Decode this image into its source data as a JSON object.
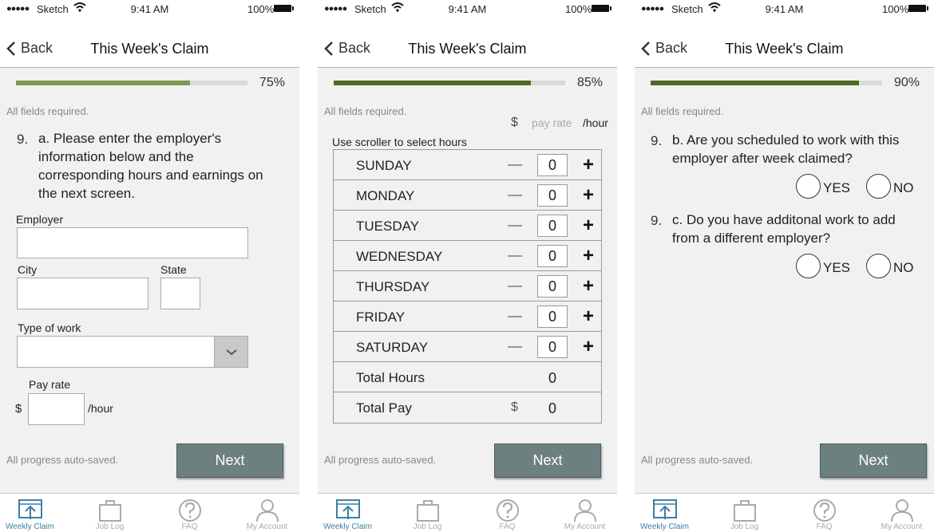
{
  "status": {
    "carrier": "Sketch",
    "time": "9:41 AM",
    "battery": "100%"
  },
  "nav": {
    "back": "Back",
    "title": "This Week's Claim"
  },
  "colors": {
    "progress_light": "#7a9a52",
    "progress_dark": "#4e6b24",
    "button": "#6d8080",
    "active_tab": "#3d7fa6"
  },
  "common": {
    "required": "All fields required.",
    "autosave": "All progress auto-saved.",
    "next": "Next"
  },
  "tabs": [
    {
      "label": "Weekly Claim",
      "icon": "upload-icon"
    },
    {
      "label": "Job Log",
      "icon": "briefcase-icon"
    },
    {
      "label": "FAQ",
      "icon": "question-icon"
    },
    {
      "label": "My Account",
      "icon": "person-icon"
    }
  ],
  "screen1": {
    "progress": 0.75,
    "progress_label": "75%",
    "question_num": "9.",
    "question": "a. Please enter the employer's information below and the corresponding hours and earnings on the next screen.",
    "employer_label": "Employer",
    "city_label": "City",
    "state_label": "State",
    "type_label": "Type of work",
    "payrate_label": "Pay rate",
    "dollar": "$",
    "per_hour": "/hour"
  },
  "screen2": {
    "progress": 0.85,
    "progress_label": "85%",
    "dollar": "$",
    "payrate_placeholder": "pay rate",
    "per_hour": "/hour",
    "scroller_hint": "Use scroller to select hours",
    "days": [
      {
        "name": "SUNDAY",
        "value": "0"
      },
      {
        "name": "MONDAY",
        "value": "0"
      },
      {
        "name": "TUESDAY",
        "value": "0"
      },
      {
        "name": "WEDNESDAY",
        "value": "0"
      },
      {
        "name": "THURSDAY",
        "value": "0"
      },
      {
        "name": "FRIDAY",
        "value": "0"
      },
      {
        "name": "SATURDAY",
        "value": "0"
      }
    ],
    "total_hours_label": "Total Hours",
    "total_hours": "0",
    "total_pay_label": "Total Pay",
    "total_pay_dollar": "$",
    "total_pay": "0"
  },
  "screen3": {
    "progress": 0.9,
    "progress_label": "90%",
    "q_b_num": "9.",
    "q_b": "b. Are you scheduled to work with this employer after week claimed?",
    "q_c_num": "9.",
    "q_c": "c. Do you have additonal work to add from a different employer?",
    "yes": "YES",
    "no": "NO"
  }
}
